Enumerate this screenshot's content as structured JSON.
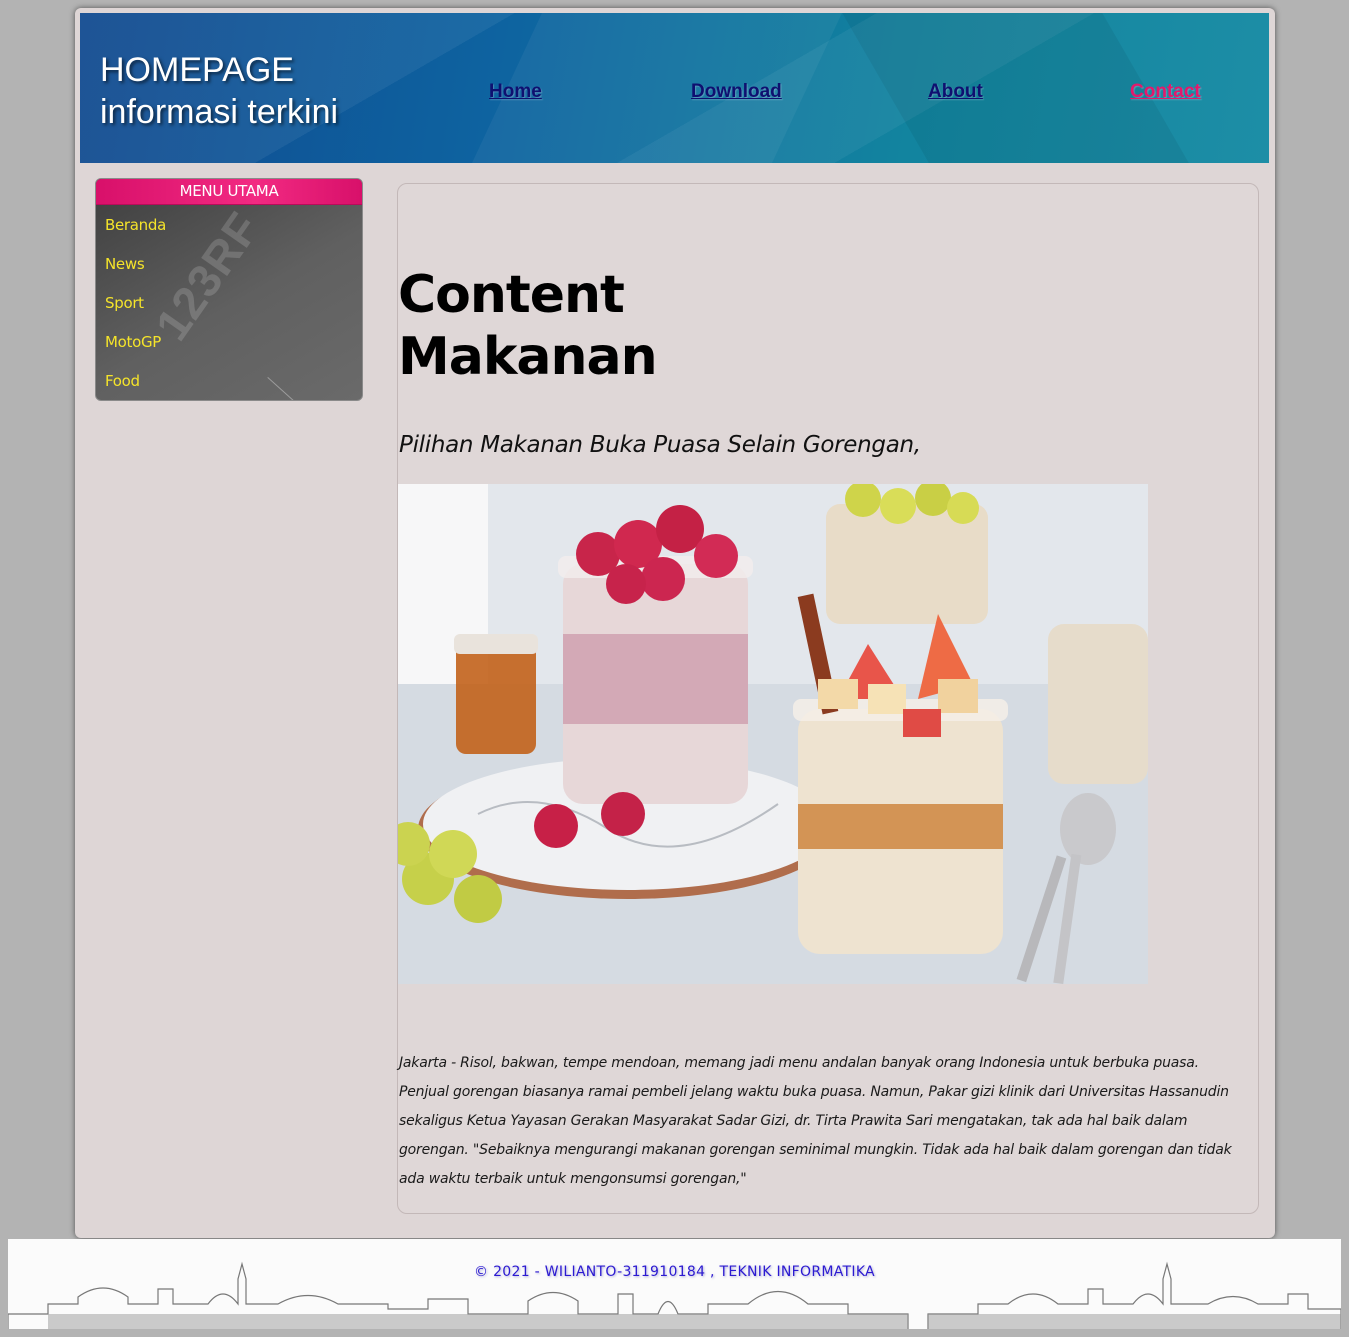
{
  "header": {
    "title_line1": "HOMEPAGE",
    "title_line2": "informasi terkini",
    "nav": [
      {
        "label": "Home"
      },
      {
        "label": "Download"
      },
      {
        "label": "About"
      },
      {
        "label": "Contact",
        "active": true
      }
    ]
  },
  "sidebar": {
    "title": "MENU UTAMA",
    "watermark": "123RF",
    "items": [
      {
        "label": "Beranda"
      },
      {
        "label": "News"
      },
      {
        "label": "Sport"
      },
      {
        "label": "MotoGP"
      },
      {
        "label": "Food"
      }
    ]
  },
  "content": {
    "title_line1": "Content",
    "title_line2": "Makanan",
    "subtitle": "Pilihan Makanan Buka Puasa Selain Gorengan,",
    "image_alt": "overnight-oats-jars-icon",
    "article": "Jakarta - Risol, bakwan, tempe mendoan, memang jadi menu andalan banyak orang Indonesia untuk berbuka puasa. Penjual gorengan biasanya ramai pembeli jelang waktu buka puasa. Namun, Pakar gizi klinik dari Universitas Hassanudin sekaligus Ketua Yayasan Gerakan Masyarakat Sadar Gizi, dr. Tirta Prawita Sari mengatakan, tak ada hal baik dalam gorengan. \"Sebaiknya mengurangi makanan gorengan seminimal mungkin. Tidak ada hal baik dalam gorengan dan tidak ada waktu terbaik untuk mengonsumsi gorengan,\""
  },
  "footer": {
    "text": "© 2021 - WILIANTO-311910184 , TEKNIK INFORMATIKA"
  },
  "colors": {
    "nav_link": "#0f1070",
    "nav_active": "#e2196c",
    "sidebar_header": "#f22a82",
    "sidebar_link": "#f5e42a",
    "footer_text": "#2c1ad1"
  }
}
